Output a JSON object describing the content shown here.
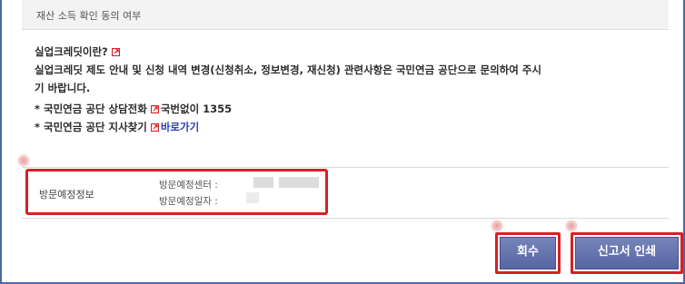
{
  "consent": {
    "label": "재산 소득 확인 동의 여부"
  },
  "notice": {
    "heading": "실업크레딧이란?",
    "body_line1": "실업크레딧 제도 안내 및 신청 내역 변경(신청취소, 정보변경, 재신청) 관련사항은 국민연금 공단으로 문의하여 주시",
    "body_line2": "기 바랍니다.",
    "phone_prefix": "* 국민연금 공단 상담전화",
    "phone_value": "국번없이 1355",
    "branch_prefix": "* 국민연금 공단 지사찾기",
    "branch_link": "바로가기"
  },
  "visit": {
    "title": "방문예정정보",
    "center_label": "방문예정센터 :",
    "date_label": "방문예정일자 :"
  },
  "actions": {
    "withdraw_label": "회수",
    "print_label": "신고서 인쇄"
  },
  "colors": {
    "highlight": "#d81f26",
    "button": "#5c6ba6",
    "link": "#2b3eb5",
    "frame": "#4a6aa5"
  }
}
